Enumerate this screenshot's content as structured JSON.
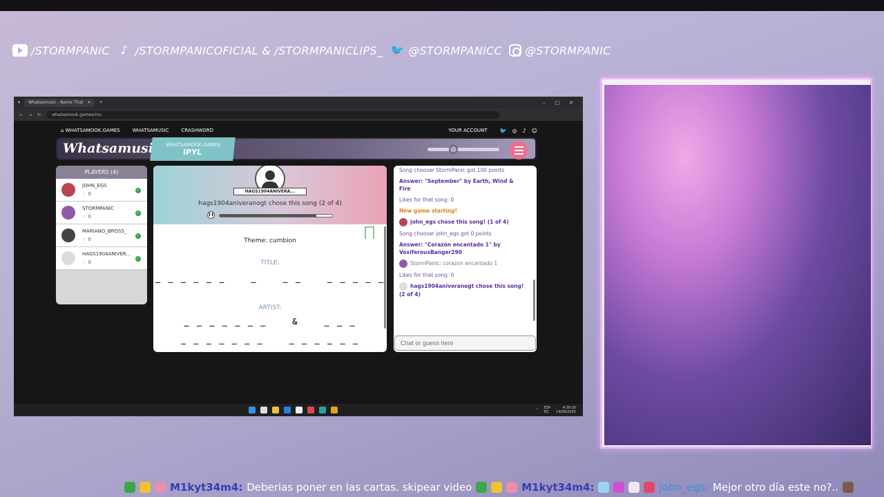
{
  "socials": [
    {
      "icon": "youtube-icon",
      "text": "/STORMPANIC"
    },
    {
      "icon": "tiktok-icon",
      "text": "/STORMPANICOFICIAL & /STORMPANICLIPS_"
    },
    {
      "icon": "twitter-icon",
      "text": "@STORMPANICC"
    },
    {
      "icon": "instagram-icon",
      "text": "@STORMPANIC"
    }
  ],
  "browser": {
    "tab_title": "Whatsamusic - Name That",
    "url": "whatsamook.games/mu",
    "controls": [
      "–",
      "□",
      "✕"
    ]
  },
  "site": {
    "nav": [
      "WHATSAMOOK.GAMES",
      "WHATSAMUSIC",
      "CRASHWORD"
    ],
    "account": "YOUR ACCOUNT",
    "logo": "Whatsamusic",
    "room_site": "WHATSAMOOK.GAMES",
    "room_code": "IPYL",
    "volume_level": 0.3
  },
  "players": {
    "header": "PLAYERS (4)",
    "list": [
      {
        "name": "JOHN_EGS",
        "score": "0",
        "avatar_color": "#b8454f"
      },
      {
        "name": "STORMPANIC",
        "score": "0",
        "avatar_color": "#8e5aa8"
      },
      {
        "name": "MARIANO_BROSS_",
        "score": "0",
        "avatar_color": "#444444"
      },
      {
        "name": "HAGS1904ANIVER...",
        "score": "0",
        "avatar_color": "#dddddd"
      }
    ]
  },
  "game": {
    "chooser_tag": "HAGS1904ANIVERA...",
    "chose_line": "hags1904aniveranogt chose this song (2 of 4)",
    "progress": 0.86,
    "pause_icon": "❚❚",
    "theme": "Theme: cumbion",
    "title_label": "TITLE:",
    "title_blanks": "_ _ _ _ _ _    _    _ _    _ _ _ _ _",
    "artist_label": "ARTIST:",
    "artist_blanks_1": "_ _ _ _ _ _ _    &    _ _ _",
    "artist_blanks_2": "_ _ _ _ _ _ _    _ _ _ _ _ _"
  },
  "chat": {
    "messages": [
      {
        "style": "purple",
        "text": "Song chooser StormPanic got 100 points"
      },
      {
        "style": "bold",
        "text": "Answer: \"September\" by Earth, Wind & Fire"
      },
      {
        "style": "purple",
        "text": "Likes for that song: 0"
      },
      {
        "style": "orange",
        "text": "New game starting!"
      },
      {
        "style": "bold",
        "text": "john_egs chose this song! (1 of 4)",
        "avatar_color": "#b8454f"
      },
      {
        "style": "purple",
        "text": "Song chooser john_egs got 0 points"
      },
      {
        "style": "bold",
        "text": "Answer: \"Corazón encantado 1\" by VoxiferousBanger290"
      },
      {
        "style": "grey",
        "text": "StormPanic: corazon encantado 1",
        "avatar_color": "#8e5aa8"
      },
      {
        "style": "purple",
        "text": "Likes for that song: 0"
      },
      {
        "style": "bold",
        "text": "hags1904aniveranogt chose this song! (2 of 4)",
        "avatar_color": "#dddddd"
      }
    ],
    "input_placeholder": "Chat or guess here"
  },
  "taskbar": {
    "lang": "ESP\nES",
    "time": "4:39:30",
    "date": "14/08/2025",
    "icon_colors": [
      "#3b8fe0",
      "#dddddd",
      "#f0c040",
      "#2a7de1",
      "#eeeeee",
      "#e04848",
      "#2aa0a0",
      "#e8a020"
    ]
  },
  "bottom_chat": [
    {
      "user": "M1kyt34m4:",
      "text": "Deberias poner en las cartas. skipear video",
      "user_style": "cu1"
    },
    {
      "user": "M1kyt34m4:",
      "text": "",
      "user_style": "cu1"
    },
    {
      "user": "john_egs:",
      "text": "Mejor otro día este no?..",
      "user_style": "cu2"
    }
  ],
  "colors": {
    "accent_pink": "#ef6d8f",
    "accent_teal": "#7fc3c8",
    "header_purple": "#6f6384",
    "ok_green": "#2fa44a"
  }
}
